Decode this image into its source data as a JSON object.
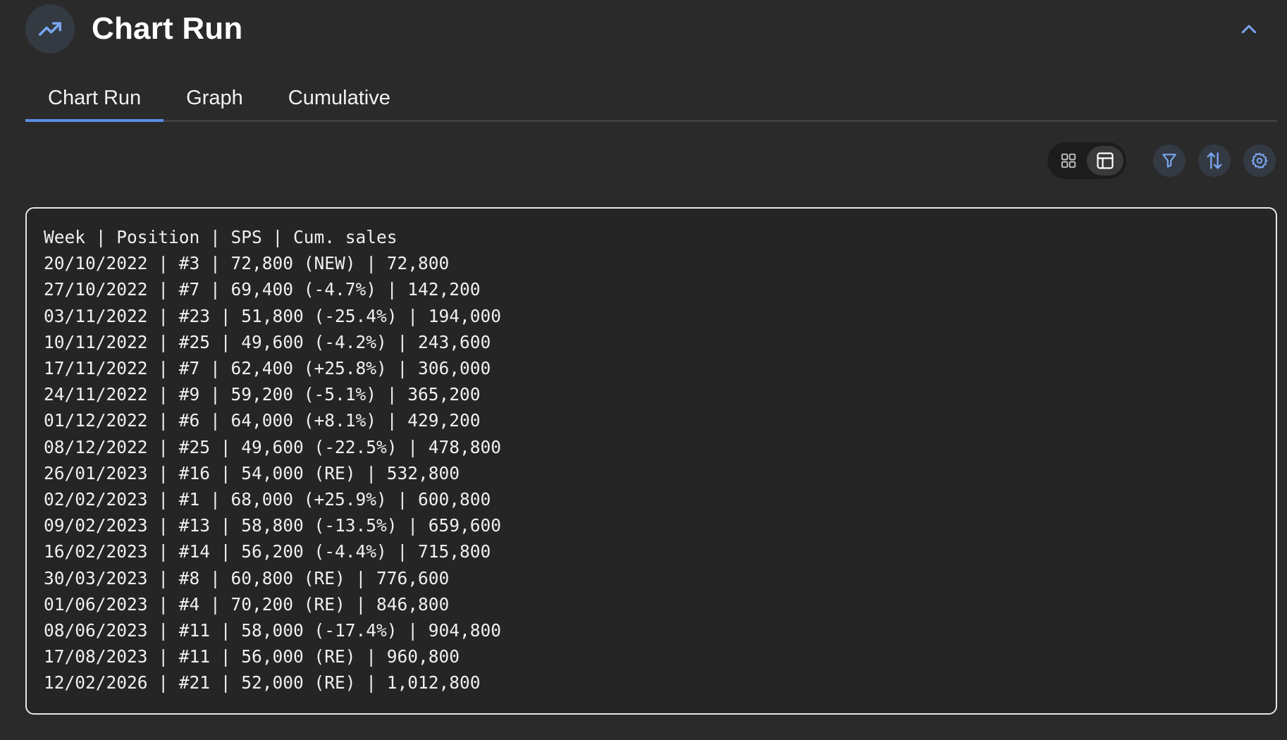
{
  "header": {
    "title": "Chart Run",
    "icon": "trending-up-icon",
    "collapse_icon": "chevron-up-icon"
  },
  "tabs": [
    {
      "label": "Chart Run",
      "active": true
    },
    {
      "label": "Graph",
      "active": false
    },
    {
      "label": "Cumulative",
      "active": false
    }
  ],
  "toolbar": {
    "view_toggle": [
      {
        "icon": "grid-view-icon",
        "active": false
      },
      {
        "icon": "table-view-icon",
        "active": true
      }
    ],
    "buttons": [
      {
        "icon": "filter-icon"
      },
      {
        "icon": "sort-icon"
      },
      {
        "icon": "settings-gear-icon"
      }
    ]
  },
  "output": {
    "lines": [
      "Week | Position | SPS | Cum. sales",
      "20/10/2022 | #3 | 72,800 (NEW) | 72,800",
      "27/10/2022 | #7 | 69,400 (-4.7%) | 142,200",
      "03/11/2022 | #23 | 51,800 (-25.4%) | 194,000",
      "10/11/2022 | #25 | 49,600 (-4.2%) | 243,600",
      "17/11/2022 | #7 | 62,400 (+25.8%) | 306,000",
      "24/11/2022 | #9 | 59,200 (-5.1%) | 365,200",
      "01/12/2022 | #6 | 64,000 (+8.1%) | 429,200",
      "08/12/2022 | #25 | 49,600 (-22.5%) | 478,800",
      "26/01/2023 | #16 | 54,000 (RE) | 532,800",
      "02/02/2023 | #1 | 68,000 (+25.9%) | 600,800",
      "09/02/2023 | #13 | 58,800 (-13.5%) | 659,600",
      "16/02/2023 | #14 | 56,200 (-4.4%) | 715,800",
      "30/03/2023 | #8 | 60,800 (RE) | 776,600",
      "01/06/2023 | #4 | 70,200 (RE) | 846,800",
      "08/06/2023 | #11 | 58,000 (-17.4%) | 904,800",
      "17/08/2023 | #11 | 56,000 (RE) | 960,800",
      "12/02/2026 | #21 | 52,000 (RE) | 1,012,800"
    ]
  },
  "colors": {
    "background": "#2a2a2a",
    "accent": "#5b8ee6",
    "icon_blue": "#7aa7f0"
  }
}
